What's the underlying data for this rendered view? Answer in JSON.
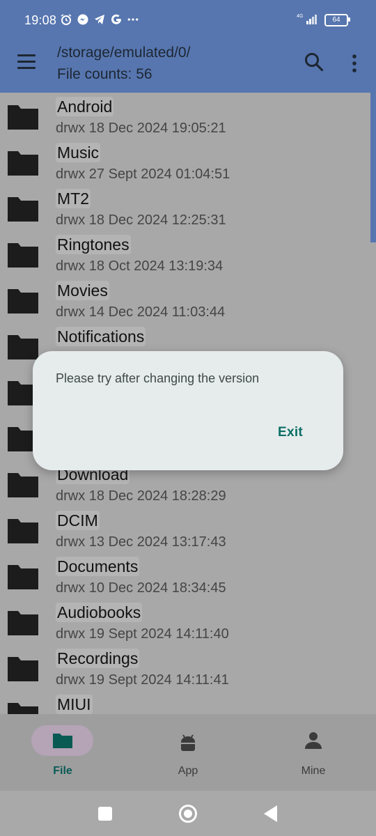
{
  "status": {
    "time": "19:08",
    "icons": [
      "alarm-icon",
      "messenger-icon",
      "telegram-icon",
      "google-icon",
      "more-notifications-icon"
    ],
    "network": "4G",
    "battery": "64"
  },
  "appbar": {
    "path": "/storage/emulated/0/",
    "file_count": "File counts: 56"
  },
  "files": [
    {
      "name": "Android",
      "meta": "drwx 18 Dec 2024 19:05:21"
    },
    {
      "name": "Music",
      "meta": "drwx 27 Sept 2024 01:04:51"
    },
    {
      "name": "MT2",
      "meta": "drwx 18 Dec 2024 12:25:31"
    },
    {
      "name": "Ringtones",
      "meta": "drwx 18 Oct 2024 13:19:34"
    },
    {
      "name": "Movies",
      "meta": "drwx 14 Dec 2024 11:03:44"
    },
    {
      "name": "Notifications",
      "meta": ""
    },
    {
      "name": "",
      "meta": ""
    },
    {
      "name": "",
      "meta": ""
    },
    {
      "name": "Download",
      "meta": "drwx 18 Dec 2024 18:28:29"
    },
    {
      "name": "DCIM",
      "meta": "drwx 13 Dec 2024 13:17:43"
    },
    {
      "name": "Documents",
      "meta": "drwx 10 Dec 2024 18:34:45"
    },
    {
      "name": "Audiobooks",
      "meta": "drwx 19 Sept 2024 14:11:40"
    },
    {
      "name": "Recordings",
      "meta": "drwx 19 Sept 2024 14:11:41"
    },
    {
      "name": "MIUI",
      "meta": ""
    }
  ],
  "dialog": {
    "message": "Please try after changing the version",
    "exit_label": "Exit"
  },
  "bottom_nav": {
    "items": [
      {
        "label": "File",
        "icon": "folder-icon",
        "active": true
      },
      {
        "label": "App",
        "icon": "android-icon",
        "active": false
      },
      {
        "label": "Mine",
        "icon": "person-icon",
        "active": false
      }
    ]
  },
  "colors": {
    "appbar_dimmed": "#5776af",
    "accent": "#0b6e66",
    "dialog_bg": "#e6eceb"
  }
}
